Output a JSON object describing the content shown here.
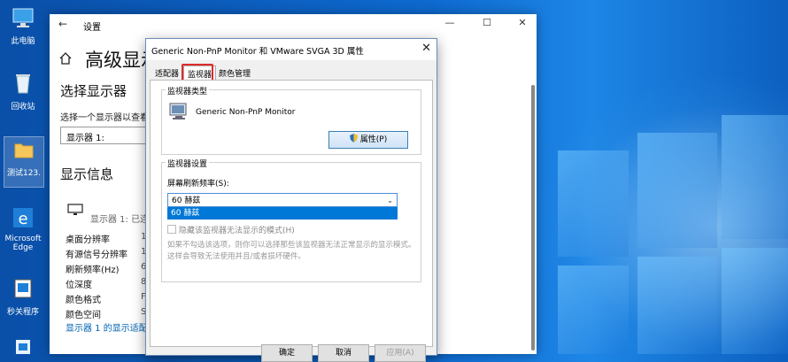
{
  "desktop": {
    "icons": [
      {
        "label": "此电脑",
        "icon": "this-pc-icon"
      },
      {
        "label": "回收站",
        "icon": "recycle-bin-icon"
      },
      {
        "label": "测试123.",
        "icon": "folder-icon"
      },
      {
        "label": "Microsoft Edge",
        "icon": "edge-icon"
      },
      {
        "label": "秒关程序",
        "icon": "program-icon"
      }
    ]
  },
  "settings": {
    "title": "设置",
    "page_title": "高级显示",
    "select_display_heading": "选择显示器",
    "select_display_prompt": "选择一个显示器以查看",
    "display_combo_value": "显示器 1:",
    "display_info_heading": "显示信息",
    "display_name": "显示器 1: 已连",
    "info_rows": [
      {
        "label": "桌面分辨率",
        "value": "1"
      },
      {
        "label": "有源信号分辨率",
        "value": "1"
      },
      {
        "label": "刷新频率(Hz)",
        "value": "6"
      },
      {
        "label": "位深度",
        "value": "8"
      },
      {
        "label": "颜色格式",
        "value": "F"
      },
      {
        "label": "颜色空间",
        "value": "S"
      }
    ],
    "adapter_link": "显示器 1 的显示适配"
  },
  "dialog": {
    "title": "Generic Non-PnP Monitor 和 VMware SVGA 3D 属性",
    "tabs": [
      "适配器",
      "监视器",
      "颜色管理"
    ],
    "active_tab": "监视器",
    "monitor_type_label": "监视器类型",
    "monitor_name": "Generic Non-PnP Monitor",
    "properties_button": "属性(P)",
    "monitor_settings_label": "监视器设置",
    "refresh_rate_label": "屏幕刷新频率(S):",
    "refresh_rate_value": "60 赫兹",
    "refresh_rate_option": "60 赫兹",
    "hide_modes_checkbox": "隐藏该监视器无法显示的模式(H)",
    "description_line1": "如果不勾选该选项，则你可以选择那些该监视器无法正常显示的显示模式。",
    "description_line2": "这样会导致无法使用并且/或者损坏硬件。",
    "ok_button": "确定",
    "cancel_button": "取消",
    "apply_button": "应用(A)",
    "highlight_color": "#e02a2a",
    "accent_color": "#0078d7"
  }
}
